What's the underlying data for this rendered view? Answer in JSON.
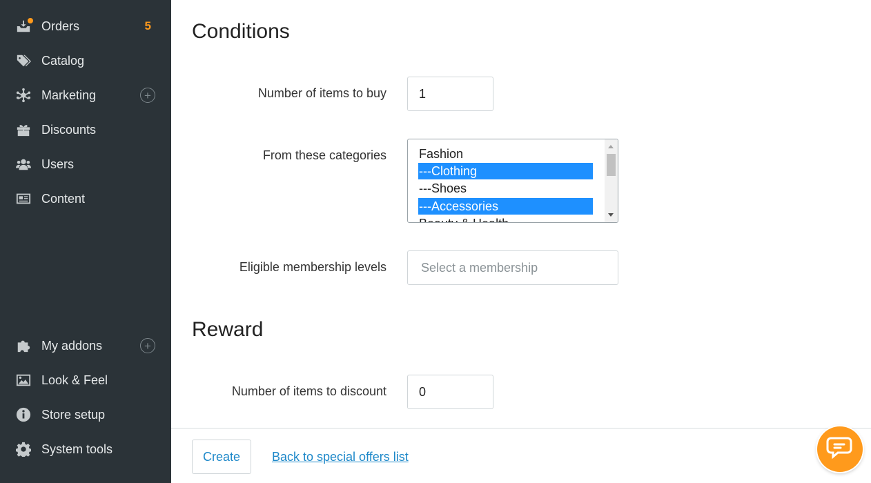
{
  "sidebar": {
    "items": [
      {
        "label": "Orders",
        "badge": "5",
        "icon": "orders-icon"
      },
      {
        "label": "Catalog",
        "icon": "tags-icon"
      },
      {
        "label": "Marketing",
        "icon": "network-icon",
        "expand": "+"
      },
      {
        "label": "Discounts",
        "icon": "gift-icon"
      },
      {
        "label": "Users",
        "icon": "users-icon"
      },
      {
        "label": "Content",
        "icon": "newspaper-icon"
      }
    ],
    "bottom_items": [
      {
        "label": "My addons",
        "icon": "puzzle-icon",
        "expand": "+"
      },
      {
        "label": "Look & Feel",
        "icon": "image-icon"
      },
      {
        "label": "Store setup",
        "icon": "info-icon"
      },
      {
        "label": "System tools",
        "icon": "gear-icon"
      }
    ]
  },
  "conditions": {
    "title": "Conditions",
    "items_to_buy": {
      "label": "Number of items to buy",
      "value": "1"
    },
    "categories": {
      "label": "From these categories",
      "options": [
        {
          "text": "Fashion",
          "selected": false
        },
        {
          "text": "---Clothing",
          "selected": true
        },
        {
          "text": "---Shoes",
          "selected": false
        },
        {
          "text": "---Accessories",
          "selected": true
        },
        {
          "text": "Beauty & Health",
          "selected": false
        }
      ]
    },
    "membership": {
      "label": "Eligible membership levels",
      "placeholder": "Select a membership"
    }
  },
  "reward": {
    "title": "Reward",
    "items_to_discount": {
      "label": "Number of items to discount",
      "value": "0"
    }
  },
  "footer": {
    "create_label": "Create",
    "back_link": "Back to special offers list"
  },
  "colors": {
    "sidebar_bg": "#2b3338",
    "accent_orange": "#ff9a1c",
    "link_blue": "#1d88c9",
    "selection_blue": "#1e90ff"
  }
}
